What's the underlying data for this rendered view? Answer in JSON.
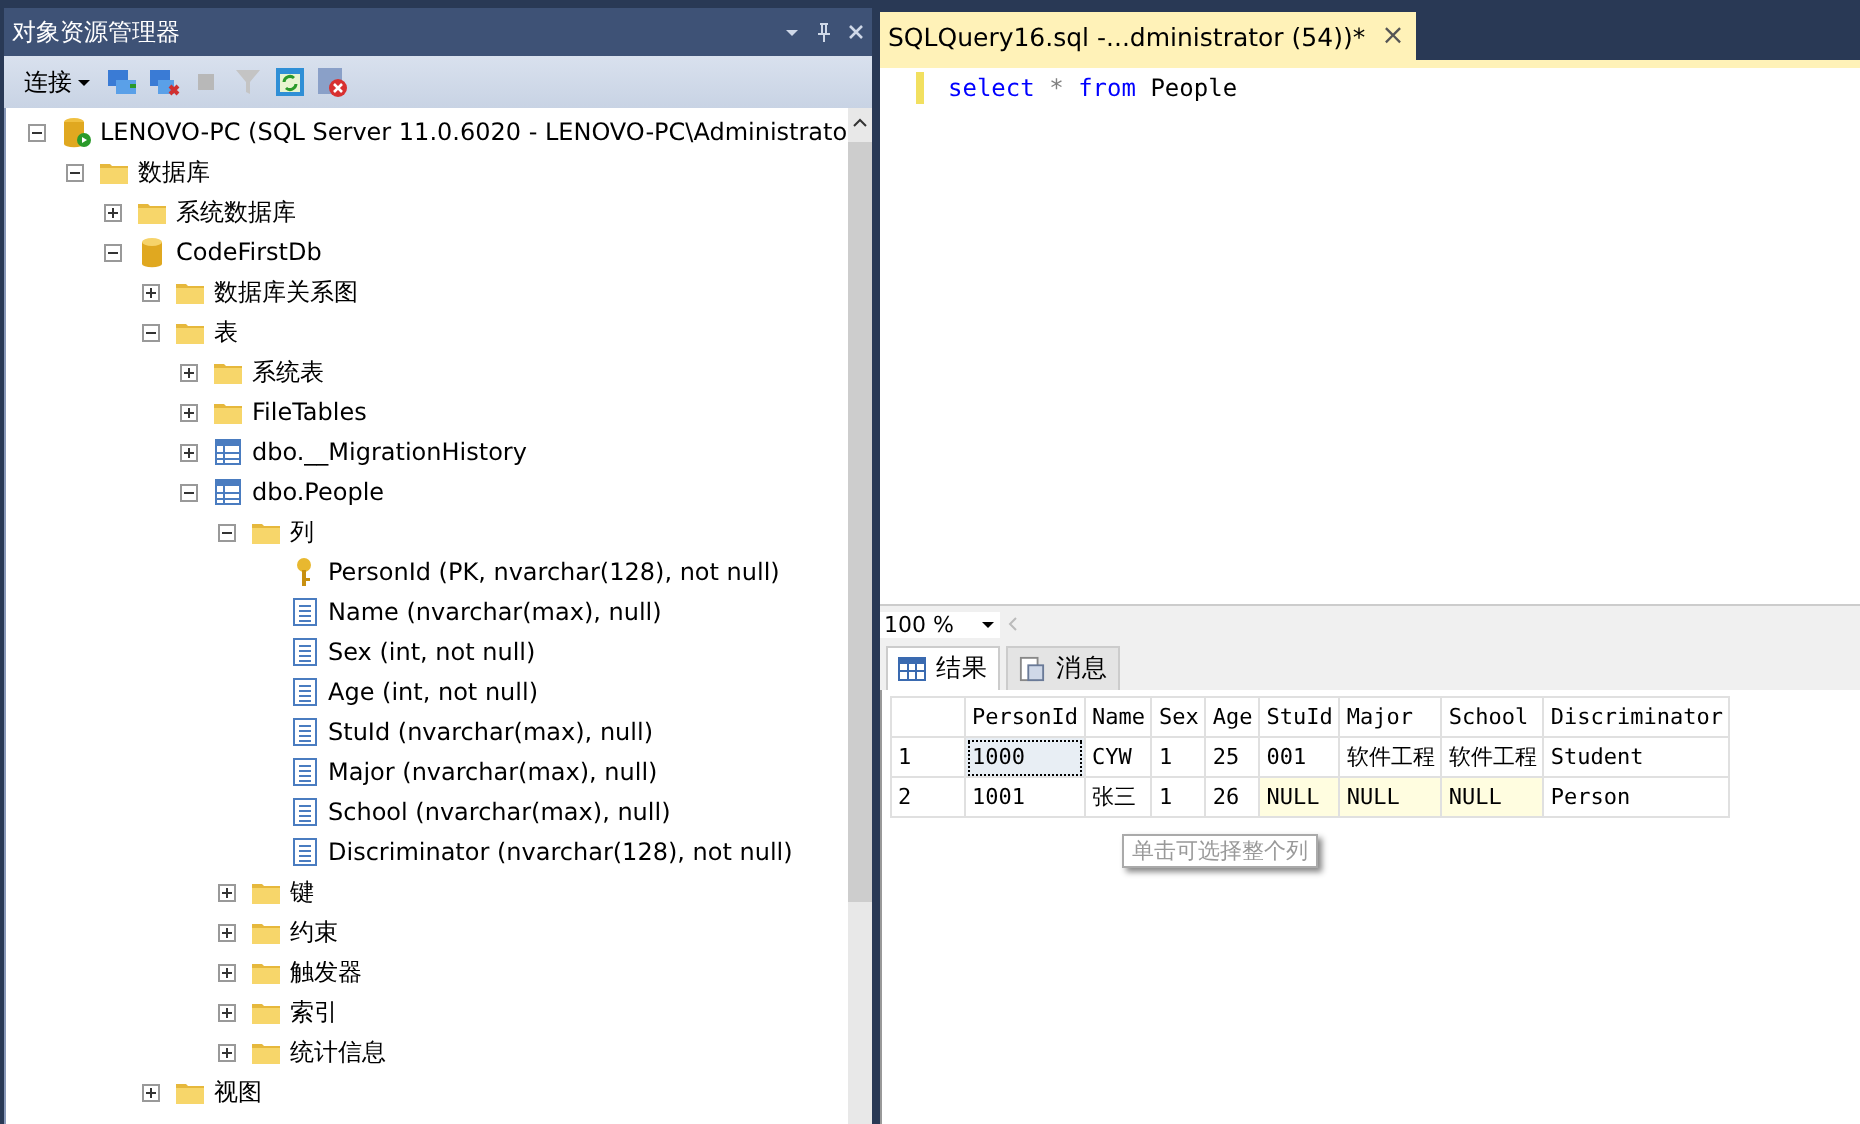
{
  "object_explorer": {
    "title": "对象资源管理器",
    "toolbar": {
      "connect": "连接"
    },
    "tree": [
      {
        "label": "LENOVO-PC (SQL Server 11.0.6020 - LENOVO-PC\\Administrato",
        "kind": "server",
        "expanded": true,
        "children": [
          {
            "label": "数据库",
            "kind": "folder",
            "expanded": true,
            "children": [
              {
                "label": "系统数据库",
                "kind": "folder",
                "expanded": false
              },
              {
                "label": "CodeFirstDb",
                "kind": "db",
                "expanded": true,
                "children": [
                  {
                    "label": "数据库关系图",
                    "kind": "folder",
                    "expanded": false
                  },
                  {
                    "label": "表",
                    "kind": "folder",
                    "expanded": true,
                    "children": [
                      {
                        "label": "系统表",
                        "kind": "folder",
                        "expanded": false
                      },
                      {
                        "label": "FileTables",
                        "kind": "folder",
                        "expanded": false
                      },
                      {
                        "label": "dbo.__MigrationHistory",
                        "kind": "table",
                        "expanded": false
                      },
                      {
                        "label": "dbo.People",
                        "kind": "table",
                        "expanded": true,
                        "children": [
                          {
                            "label": "列",
                            "kind": "folder",
                            "expanded": true,
                            "children": [
                              {
                                "label": "PersonId (PK, nvarchar(128), not null)",
                                "kind": "key"
                              },
                              {
                                "label": "Name (nvarchar(max), null)",
                                "kind": "column"
                              },
                              {
                                "label": "Sex (int, not null)",
                                "kind": "column"
                              },
                              {
                                "label": "Age (int, not null)",
                                "kind": "column"
                              },
                              {
                                "label": "StuId (nvarchar(max), null)",
                                "kind": "column"
                              },
                              {
                                "label": "Major (nvarchar(max), null)",
                                "kind": "column"
                              },
                              {
                                "label": "School (nvarchar(max), null)",
                                "kind": "column"
                              },
                              {
                                "label": "Discriminator (nvarchar(128), not null)",
                                "kind": "column"
                              }
                            ]
                          },
                          {
                            "label": "键",
                            "kind": "folder",
                            "expanded": false
                          },
                          {
                            "label": "约束",
                            "kind": "folder",
                            "expanded": false
                          },
                          {
                            "label": "触发器",
                            "kind": "folder",
                            "expanded": false
                          },
                          {
                            "label": "索引",
                            "kind": "folder",
                            "expanded": false
                          },
                          {
                            "label": "统计信息",
                            "kind": "folder",
                            "expanded": false
                          }
                        ]
                      }
                    ]
                  },
                  {
                    "label": "视图",
                    "kind": "folder",
                    "expanded": false
                  }
                ]
              }
            ]
          }
        ]
      }
    ]
  },
  "query_tab": {
    "title": "SQLQuery16.sql -...dministrator (54))*",
    "close": "×"
  },
  "editor": {
    "tokens": [
      {
        "text": "select",
        "kind": "keyword"
      },
      {
        "text": "*",
        "kind": "operator"
      },
      {
        "text": "from",
        "kind": "keyword"
      },
      {
        "text": "People",
        "kind": "name"
      }
    ]
  },
  "zoom": "100 %",
  "result_tabs": [
    {
      "label": "结果",
      "selected": true
    },
    {
      "label": "消息",
      "selected": false
    }
  ],
  "grid": {
    "columns": [
      "PersonId",
      "Name",
      "Sex",
      "Age",
      "StuId",
      "Major",
      "School",
      "Discriminator"
    ],
    "rows": [
      {
        "number": "1",
        "cells": [
          "1000",
          "CYW",
          "1",
          "25",
          "001",
          "软件工程",
          "软件工程",
          "Student"
        ]
      },
      {
        "number": "2",
        "cells": [
          "1001",
          "张三",
          "1",
          "26",
          "NULL",
          "NULL",
          "NULL",
          "Person"
        ]
      }
    ],
    "tooltip": "单击可选择整个列"
  }
}
